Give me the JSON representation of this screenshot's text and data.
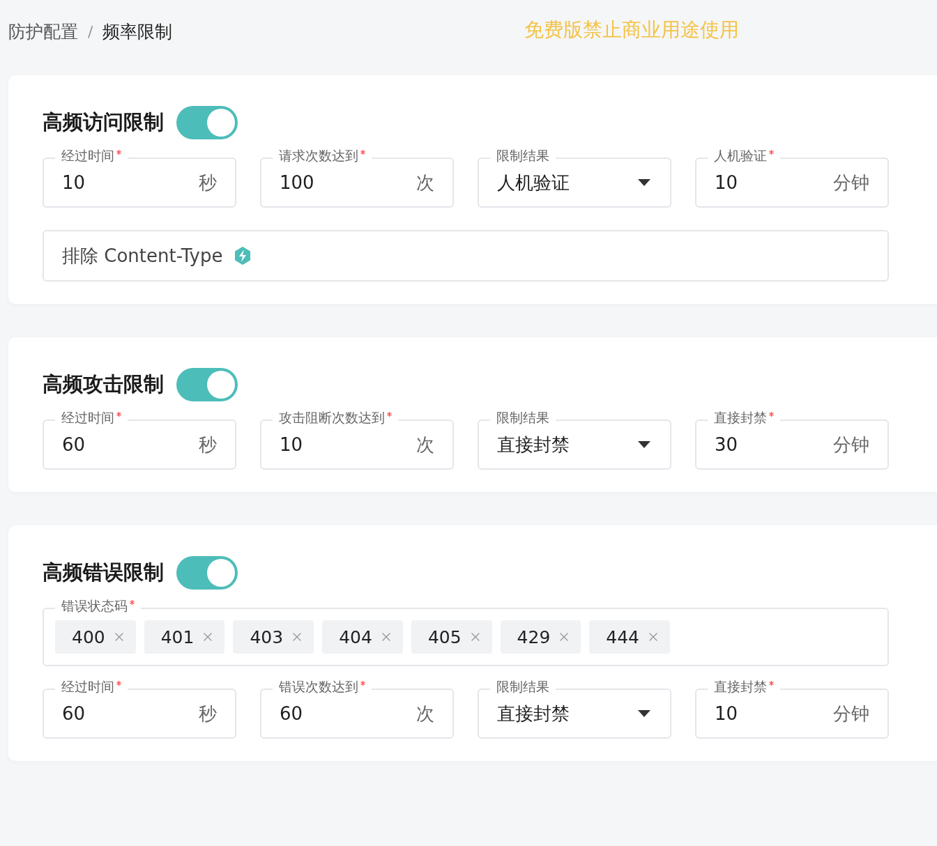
{
  "breadcrumb": {
    "separator": "/",
    "items": [
      {
        "label": "防护配置",
        "current": false
      },
      {
        "label": "频率限制",
        "current": true
      }
    ]
  },
  "notice": "免费版禁止商业用途使用",
  "sections": [
    {
      "title": "高频访问限制",
      "enabled": true,
      "fields": [
        {
          "kind": "input",
          "label": "经过时间",
          "required": true,
          "value": "10",
          "unit": "秒"
        },
        {
          "kind": "input",
          "label": "请求次数达到",
          "required": true,
          "value": "100",
          "unit": "次"
        },
        {
          "kind": "select",
          "label": "限制结果",
          "required": false,
          "value": "人机验证"
        },
        {
          "kind": "input",
          "label": "人机验证",
          "required": true,
          "value": "10",
          "unit": "分钟"
        },
        {
          "kind": "exclude",
          "placeholder": "排除 Content-Type"
        }
      ]
    },
    {
      "title": "高频攻击限制",
      "enabled": true,
      "fields": [
        {
          "kind": "input",
          "label": "经过时间",
          "required": true,
          "value": "60",
          "unit": "秒"
        },
        {
          "kind": "input",
          "label": "攻击阻断次数达到",
          "required": true,
          "value": "10",
          "unit": "次"
        },
        {
          "kind": "select",
          "label": "限制结果",
          "required": false,
          "value": "直接封禁"
        },
        {
          "kind": "input",
          "label": "直接封禁",
          "required": true,
          "value": "30",
          "unit": "分钟"
        }
      ]
    },
    {
      "title": "高频错误限制",
      "enabled": true,
      "fields": [
        {
          "kind": "tags",
          "label": "错误状态码",
          "required": true,
          "tags": [
            "400",
            "401",
            "403",
            "404",
            "405",
            "429",
            "444"
          ]
        },
        {
          "kind": "input",
          "label": "经过时间",
          "required": true,
          "value": "60",
          "unit": "秒"
        },
        {
          "kind": "input",
          "label": "错误次数达到",
          "required": true,
          "value": "60",
          "unit": "次"
        },
        {
          "kind": "select",
          "label": "限制结果",
          "required": false,
          "value": "直接封禁"
        },
        {
          "kind": "input",
          "label": "直接封禁",
          "required": true,
          "value": "10",
          "unit": "分钟"
        }
      ]
    }
  ]
}
